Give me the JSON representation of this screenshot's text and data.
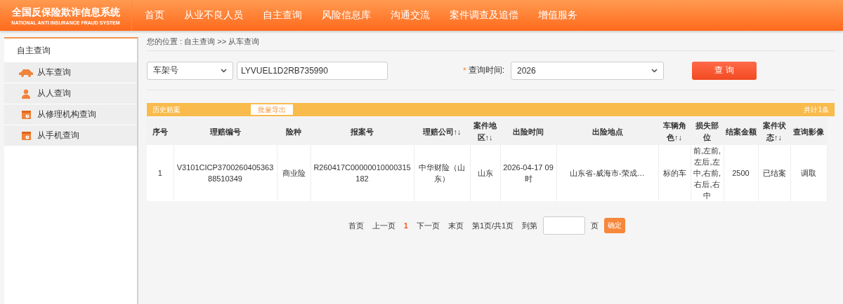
{
  "header": {
    "title": "全国反保险欺诈信息系统",
    "subtitle": "NATIONAL ANTI INSURANCE FRAUD SYSTEM",
    "nav": [
      {
        "label": "首页"
      },
      {
        "label": "从业不良人员"
      },
      {
        "label": "自主查询"
      },
      {
        "label": "风险信息库"
      },
      {
        "label": "沟通交流"
      },
      {
        "label": "案件调查及追偿"
      },
      {
        "label": "增值服务"
      }
    ]
  },
  "sidebar": {
    "title": "自主查询",
    "items": [
      {
        "label": "从车查询",
        "kind": "car"
      },
      {
        "label": "从人查询",
        "kind": "person"
      },
      {
        "label": "从修理机构查询",
        "kind": "folder"
      },
      {
        "label": "从手机查询",
        "kind": "folder"
      }
    ]
  },
  "breadcrumb": "您的位置 : 自主查询 >> 从车查询",
  "query": {
    "type_select": "车架号",
    "value": "LYVUEL1D2RB735990",
    "required_mark": "*",
    "time_label": "查询时间:",
    "time_select": "2026",
    "button": "查 询"
  },
  "table": {
    "title": "历史赔案",
    "export_button": "批量导出",
    "total": "共计1条",
    "columns": [
      "序号",
      "理赔编号",
      "险种",
      "报案号",
      "理赔公司↑↓",
      "案件地区↑↓",
      "出险时间",
      "出险地点",
      "车辆角色↑↓",
      "损失部位",
      "结案金额",
      "案件状态↑↓",
      "查询影像"
    ],
    "rows": [
      {
        "cells": [
          "1",
          "V3101CICP370026040536388510349",
          "商业险",
          "R260417C00000010000315182",
          "中华财险（山东）",
          "山东",
          "2026-04-17 09时",
          "山东省-威海市-荣成…",
          "标的车",
          "前,左前,左后,左中,右前,右后,右中",
          "2500",
          "已结案",
          "调取"
        ]
      }
    ]
  },
  "pager": {
    "first": "首页",
    "prev": "上一页",
    "pages": [
      {
        "label": "1",
        "selected": true
      }
    ],
    "next": "下一页",
    "last": "末页",
    "info": "第1页/共1页",
    "goto": "到第",
    "unit": "页",
    "confirm": "确定"
  }
}
